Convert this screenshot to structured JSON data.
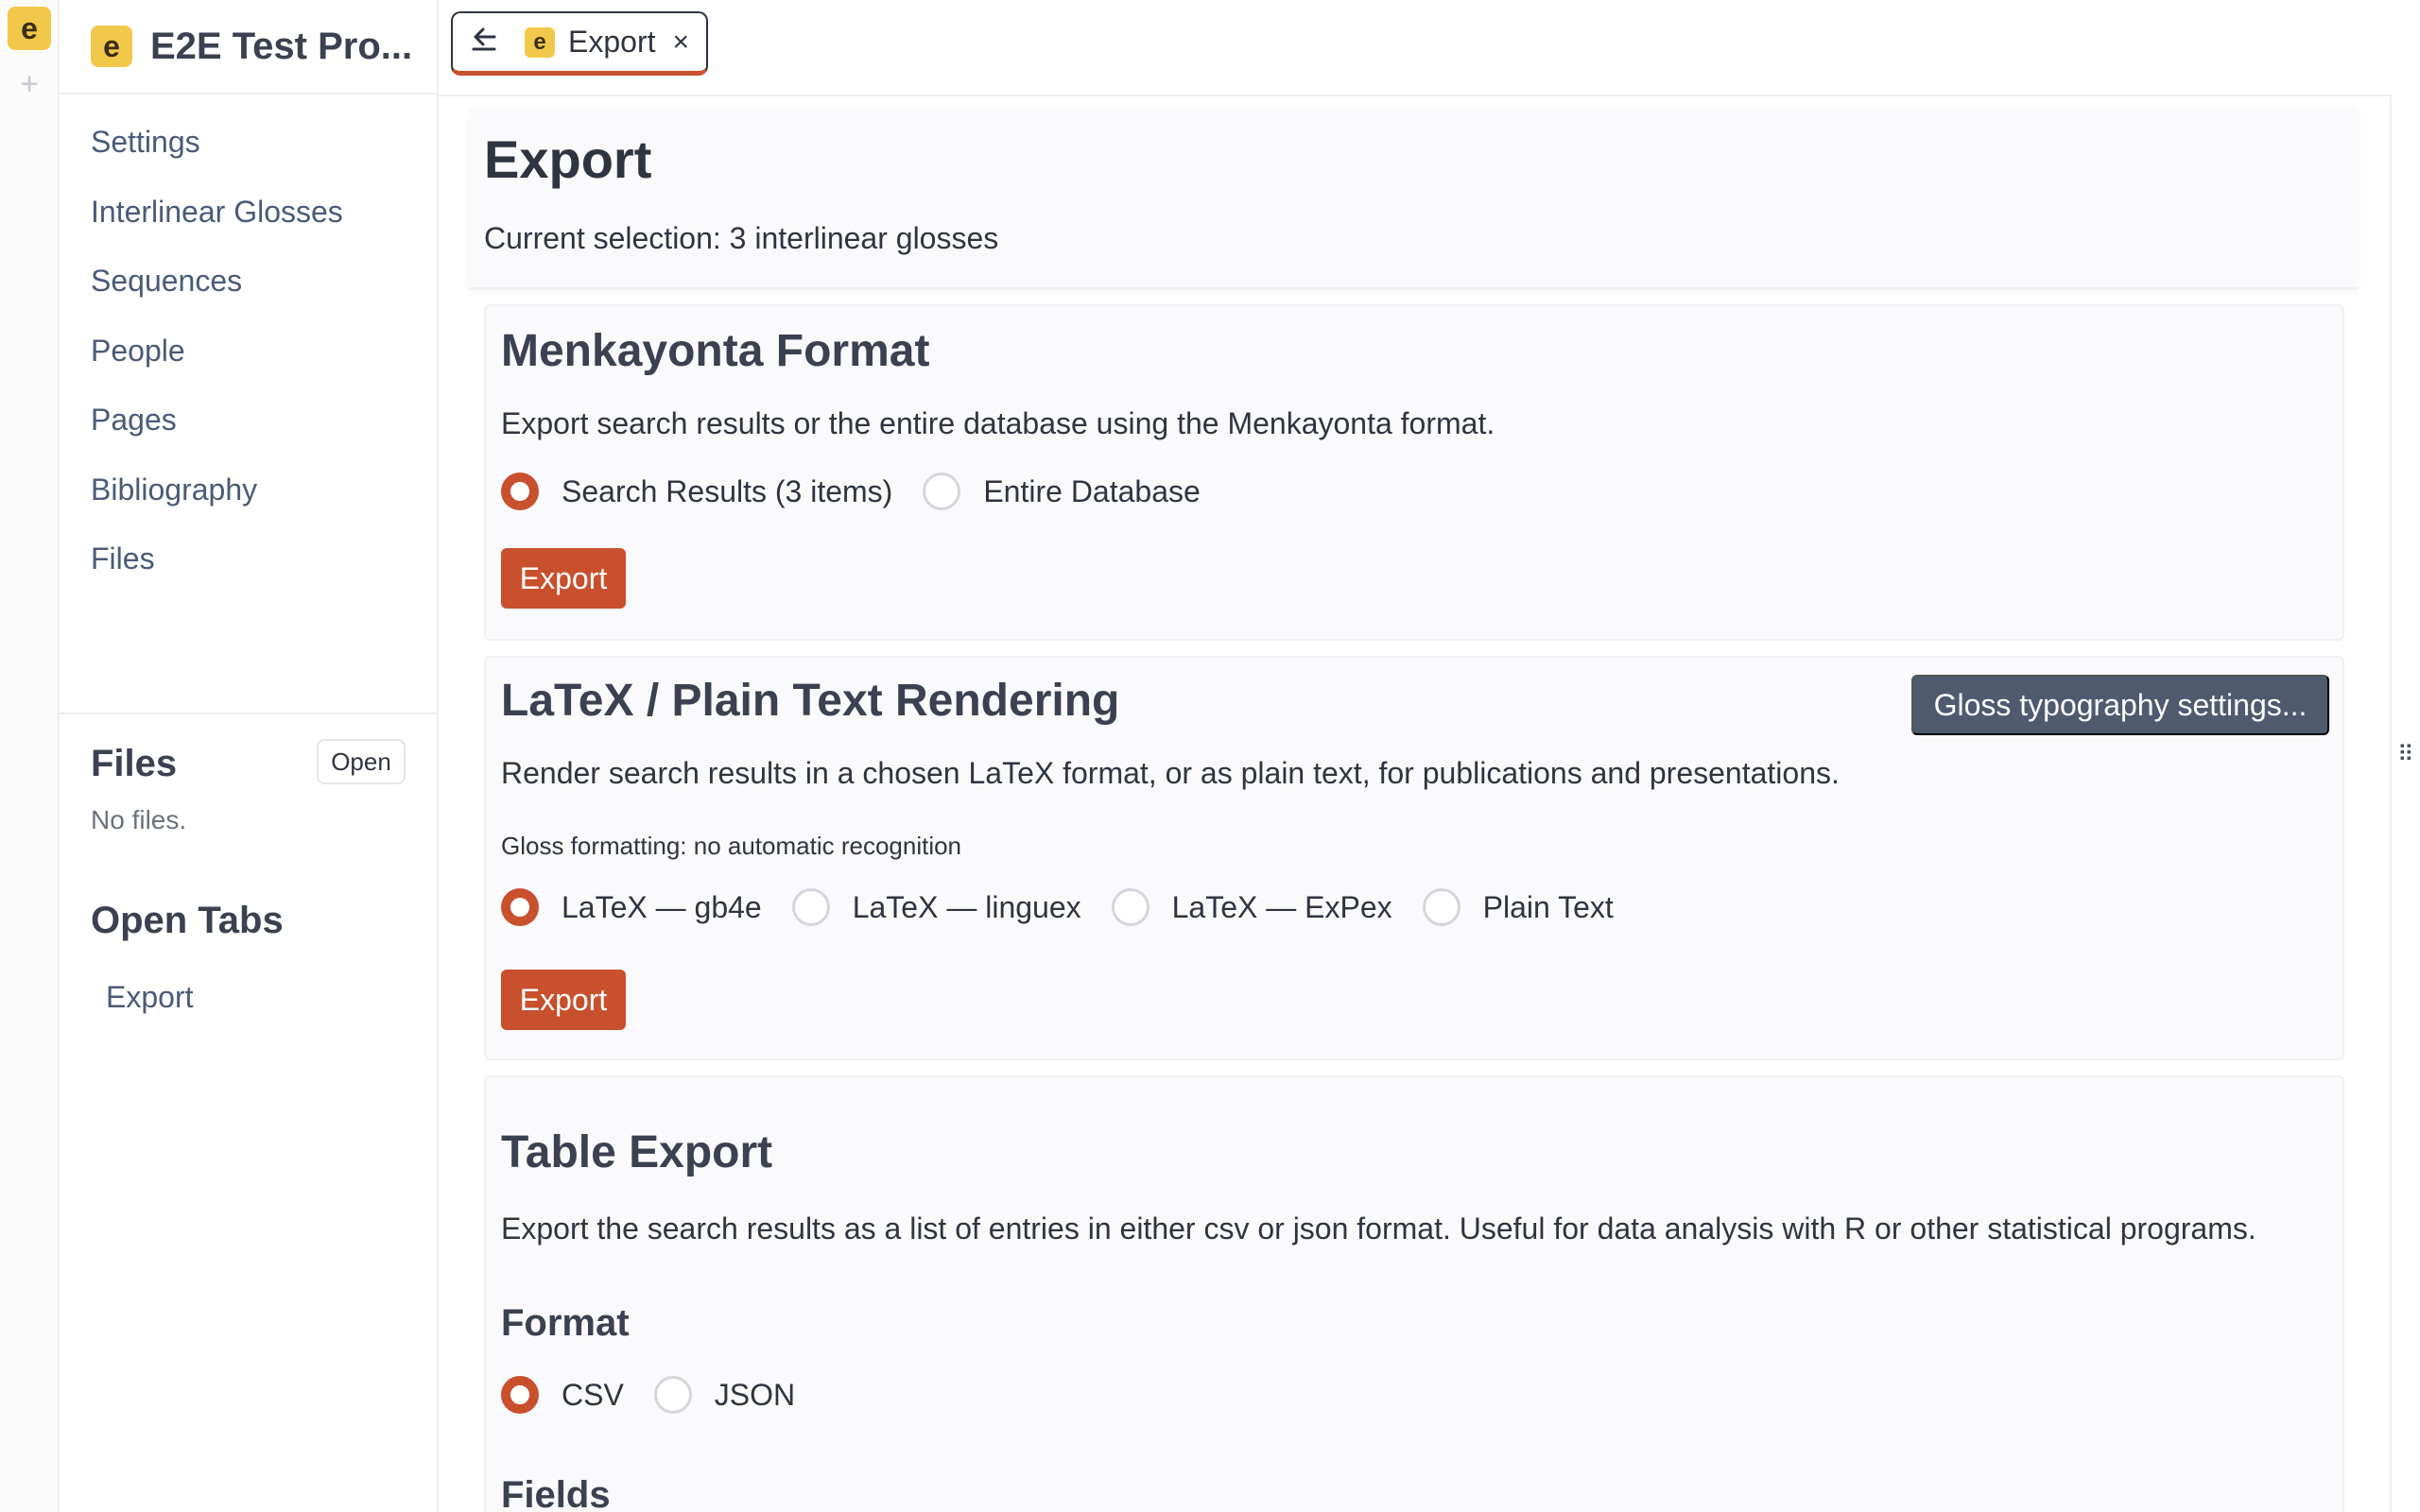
{
  "app": {
    "logo_letter": "e",
    "project_title": "E2E Test Pro..."
  },
  "rail": {
    "add_symbol": "+"
  },
  "sidebar": {
    "nav": [
      {
        "label": "Settings"
      },
      {
        "label": "Interlinear Glosses"
      },
      {
        "label": "Sequences"
      },
      {
        "label": "People"
      },
      {
        "label": "Pages"
      },
      {
        "label": "Bibliography"
      },
      {
        "label": "Files"
      }
    ],
    "files": {
      "title": "Files",
      "open_label": "Open",
      "empty_text": "No files."
    },
    "open_tabs": {
      "title": "Open Tabs",
      "items": [
        {
          "label": "Export"
        }
      ]
    }
  },
  "tabbar": {
    "back_icon": "arrow-left-icon",
    "tab_label": "Export",
    "close_symbol": "×"
  },
  "page": {
    "title": "Export",
    "subtitle": "Current selection: 3 interlinear glosses"
  },
  "menkayonta": {
    "title": "Menkayonta Format",
    "description": "Export search results or the entire database using the Menkayonta format.",
    "options": [
      {
        "label": "Search Results (3 items)",
        "checked": true
      },
      {
        "label": "Entire Database",
        "checked": false
      }
    ],
    "export_label": "Export"
  },
  "latex": {
    "title": "LaTeX / Plain Text Rendering",
    "settings_button": "Gloss typography settings...",
    "description": "Render search results in a chosen LaTeX format, or as plain text, for publications and presentations.",
    "gloss_note": "Gloss formatting: no automatic recognition",
    "options": [
      {
        "label": "LaTeX — gb4e",
        "checked": true
      },
      {
        "label": "LaTeX — linguex",
        "checked": false
      },
      {
        "label": "LaTeX — ExPex",
        "checked": false
      },
      {
        "label": "Plain Text",
        "checked": false
      }
    ],
    "export_label": "Export"
  },
  "table_export": {
    "title": "Table Export",
    "description": "Export the search results as a list of entries in either csv or json format. Useful for data analysis with R or other statistical programs.",
    "format_heading": "Format",
    "options": [
      {
        "label": "CSV",
        "checked": true
      },
      {
        "label": "JSON",
        "checked": false
      }
    ],
    "fields_heading": "Fields"
  },
  "colors": {
    "accent": "#c8502c",
    "logo": "#f2c84b",
    "secondary_button": "#4f5a6e"
  }
}
